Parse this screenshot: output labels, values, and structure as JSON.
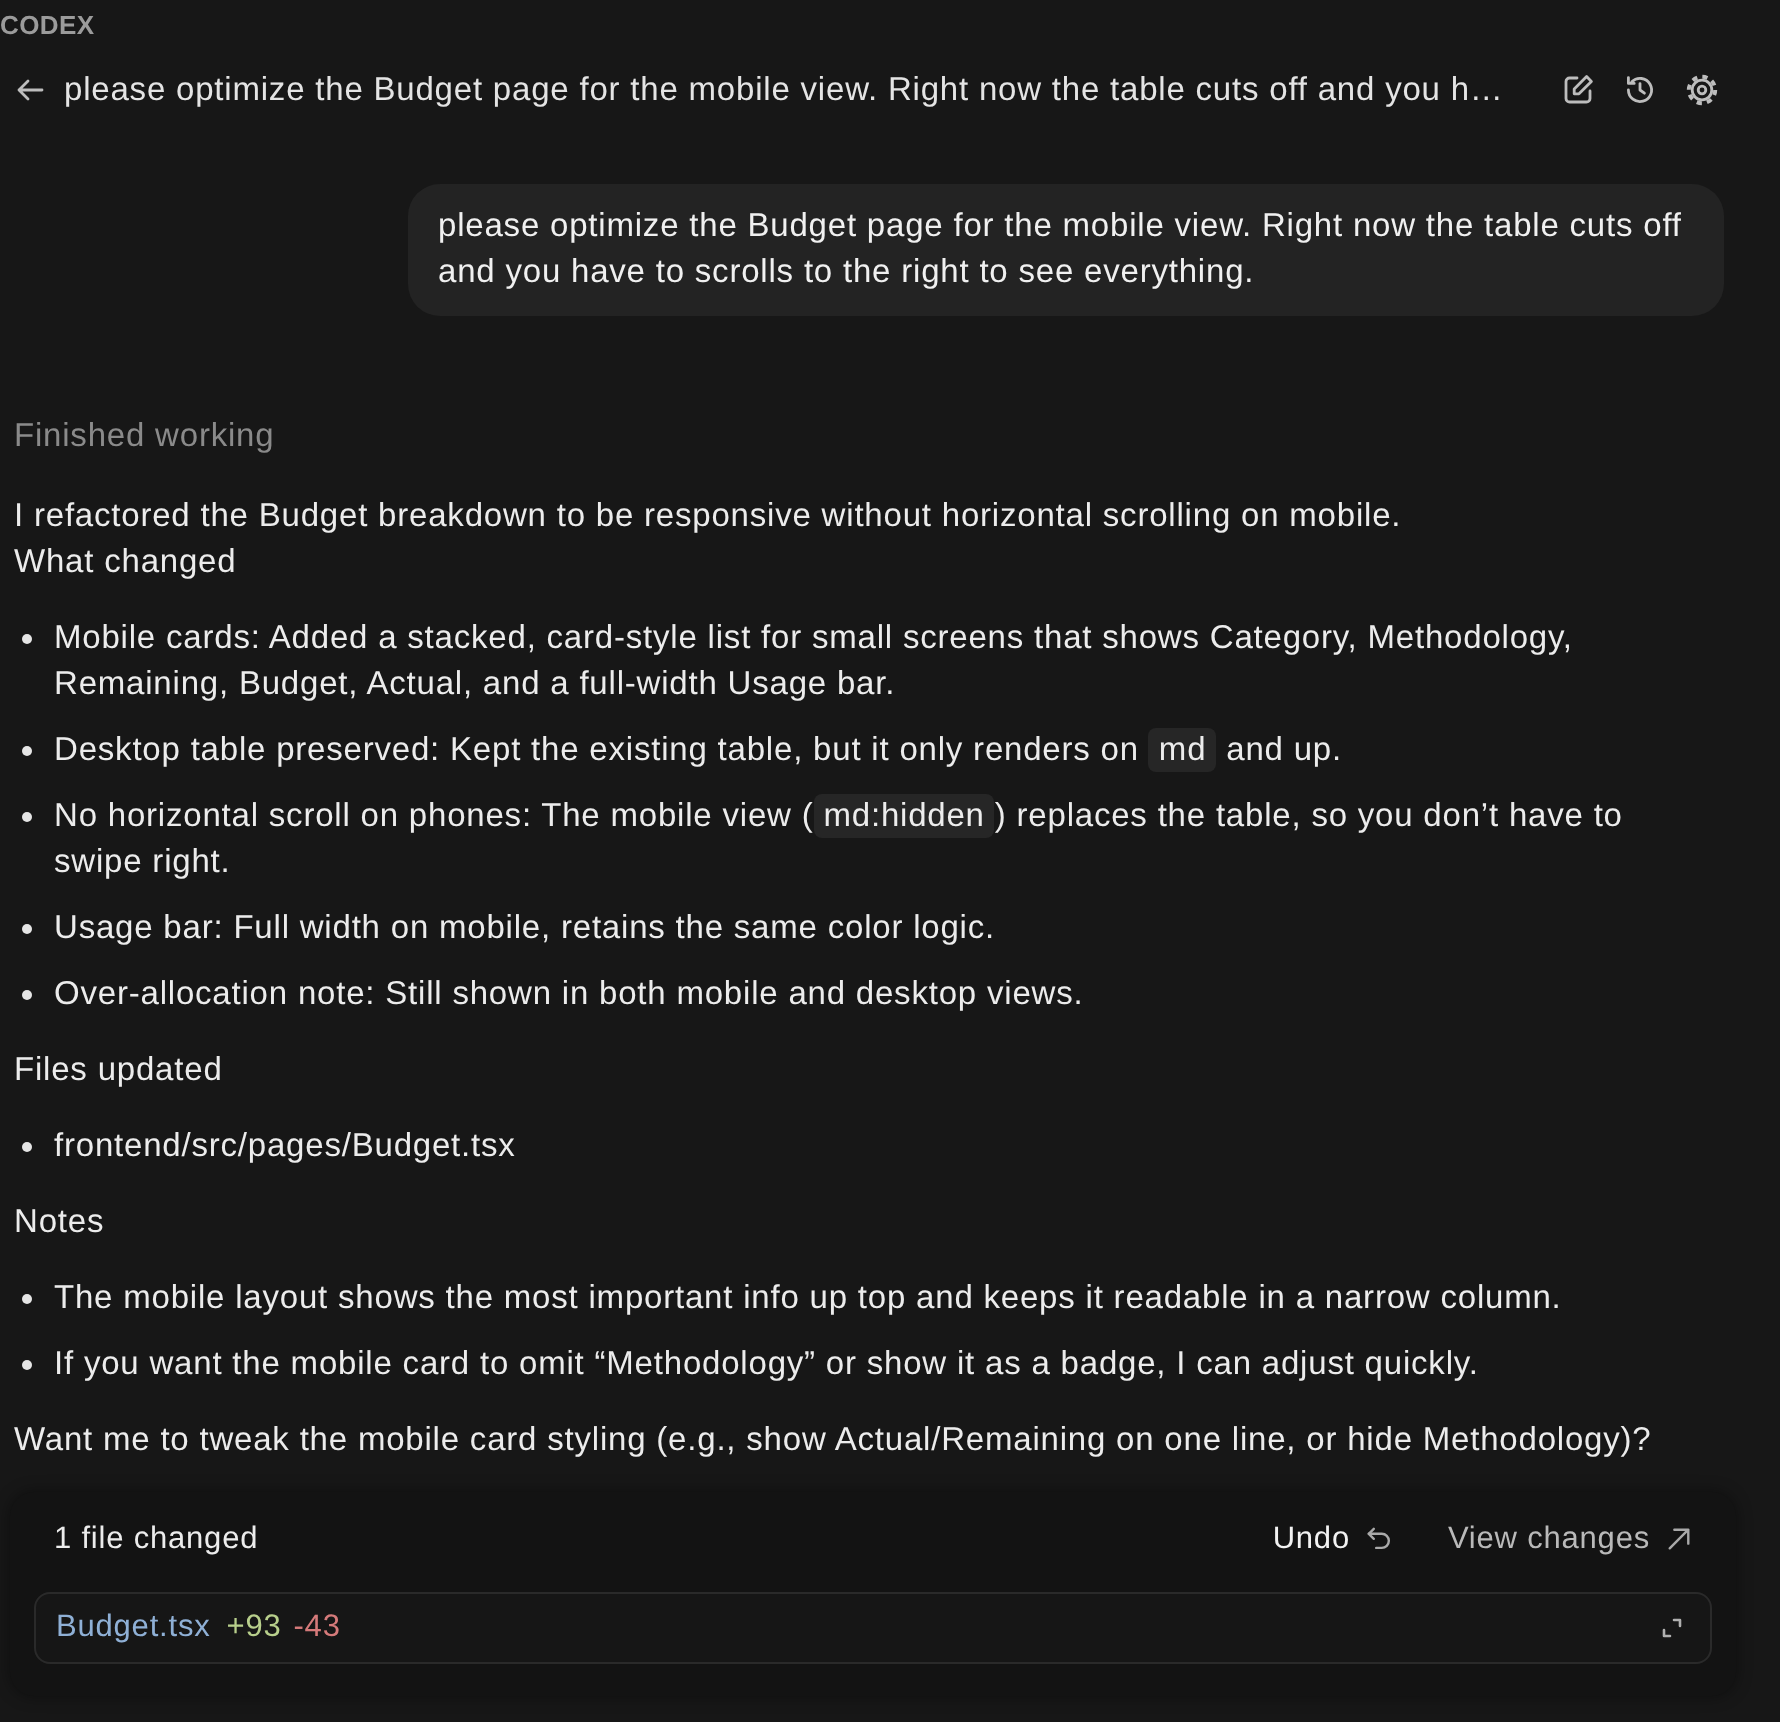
{
  "app": {
    "name": "CODEX"
  },
  "header": {
    "title": "please optimize the Budget page for the mobile view. Right now the table cuts off and you h…"
  },
  "user_message": {
    "text": "please optimize the Budget page for the mobile view. Right now the table cuts off and you have to scrolls to the right to see everything."
  },
  "status": "Finished working",
  "response": [
    {
      "kind": "paragraph",
      "text": "I refactored the Budget breakdown to be responsive without horizontal scrolling on mobile."
    },
    {
      "kind": "paragraph",
      "text": "What changed"
    },
    {
      "kind": "list",
      "items": [
        {
          "segments": [
            {
              "kind": "text",
              "text": "Mobile cards: Added a stacked, card-style list for small screens that shows Category, Methodology, Remaining, Budget, Actual, and a full-width Usage bar."
            }
          ]
        },
        {
          "segments": [
            {
              "kind": "text",
              "text": "Desktop table preserved: Kept the existing table, but it only renders on "
            },
            {
              "kind": "code",
              "text": "md"
            },
            {
              "kind": "text",
              "text": " and up."
            }
          ]
        },
        {
          "segments": [
            {
              "kind": "text",
              "text": "No horizontal scroll on phones: The mobile view ("
            },
            {
              "kind": "code",
              "text": "md:hidden"
            },
            {
              "kind": "text",
              "text": ") replaces the table, so you don’t have to swipe right."
            }
          ]
        },
        {
          "segments": [
            {
              "kind": "text",
              "text": "Usage bar: Full width on mobile, retains the same color logic."
            }
          ]
        },
        {
          "segments": [
            {
              "kind": "text",
              "text": "Over-allocation note: Still shown in both mobile and desktop views."
            }
          ]
        }
      ]
    },
    {
      "kind": "paragraph",
      "text": "Files updated"
    },
    {
      "kind": "list",
      "items": [
        {
          "segments": [
            {
              "kind": "text",
              "text": "frontend/src/pages/Budget.tsx"
            }
          ]
        }
      ]
    },
    {
      "kind": "paragraph",
      "text": "Notes"
    },
    {
      "kind": "list",
      "items": [
        {
          "segments": [
            {
              "kind": "text",
              "text": "The mobile layout shows the most important info up top and keeps it readable in a narrow column."
            }
          ]
        },
        {
          "segments": [
            {
              "kind": "text",
              "text": "If you want the mobile card to omit “Methodology” or show it as a badge, I can adjust quickly."
            }
          ]
        }
      ]
    },
    {
      "kind": "paragraph",
      "text": "Want me to tweak the mobile card styling (e.g., show Actual/Remaining on one line, or hide Methodology)?"
    }
  ],
  "changes": {
    "summary": "1 file changed",
    "actions": [
      {
        "kind": "undo",
        "label": "Undo"
      },
      {
        "kind": "view",
        "label": "View changes"
      }
    ],
    "files": [
      {
        "name": "Budget.tsx",
        "added": "+93",
        "removed": "-43"
      }
    ]
  }
}
